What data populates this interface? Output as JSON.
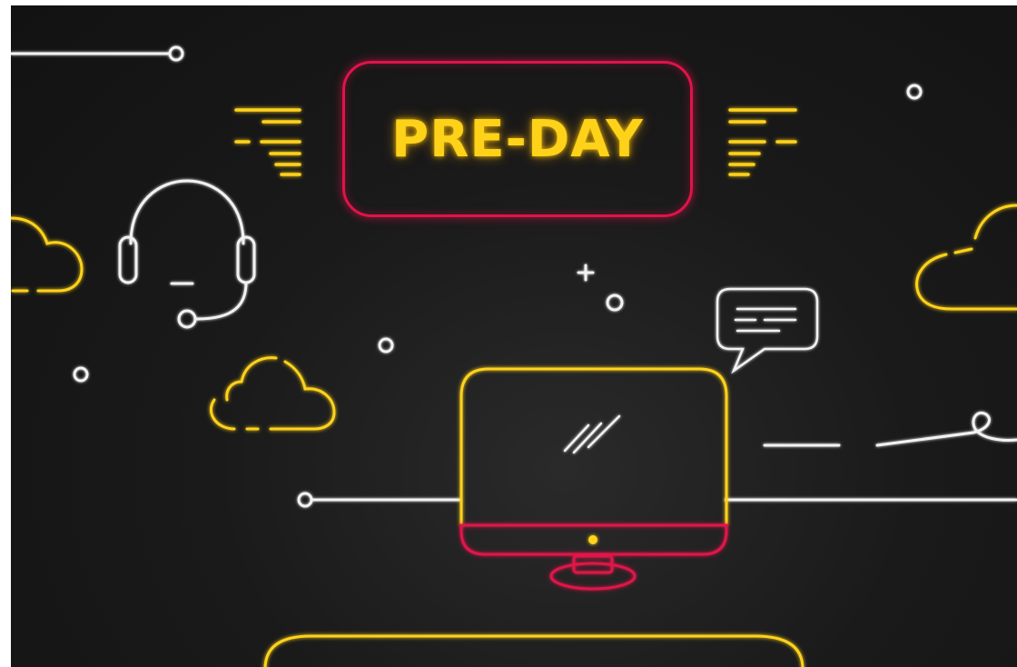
{
  "banner": {
    "title": "PRE-DAY"
  },
  "colors": {
    "background": "#161616",
    "neon_yellow": "#ffd21a",
    "neon_red": "#e0134a",
    "neon_white": "#f2f2f2"
  },
  "icons": [
    "headset-icon",
    "cloud-icon",
    "chat-bubble-icon",
    "monitor-icon",
    "speed-lines-icon",
    "plus-icon",
    "circle-node-icon"
  ]
}
